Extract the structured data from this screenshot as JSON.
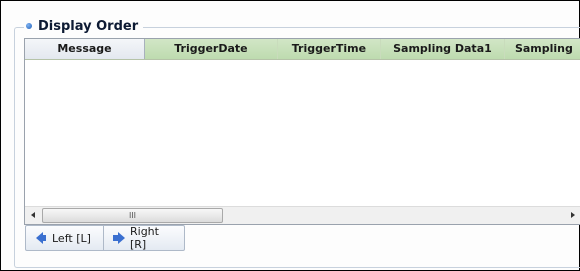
{
  "group": {
    "title": "Display Order"
  },
  "grid": {
    "columns": [
      {
        "label": "Message"
      },
      {
        "label": "TriggerDate"
      },
      {
        "label": "TriggerTime"
      },
      {
        "label": "Sampling Data1"
      },
      {
        "label": "Sampling"
      }
    ],
    "rows": []
  },
  "scrollbar": {
    "grip": "III"
  },
  "buttons": {
    "left": {
      "label": "Left [L]"
    },
    "right": {
      "label": "Right [R]"
    }
  },
  "colors": {
    "header_green": "#c6e0b4",
    "arrow_blue": "#3a6fd0",
    "bullet_blue": "#1f5fb8"
  }
}
